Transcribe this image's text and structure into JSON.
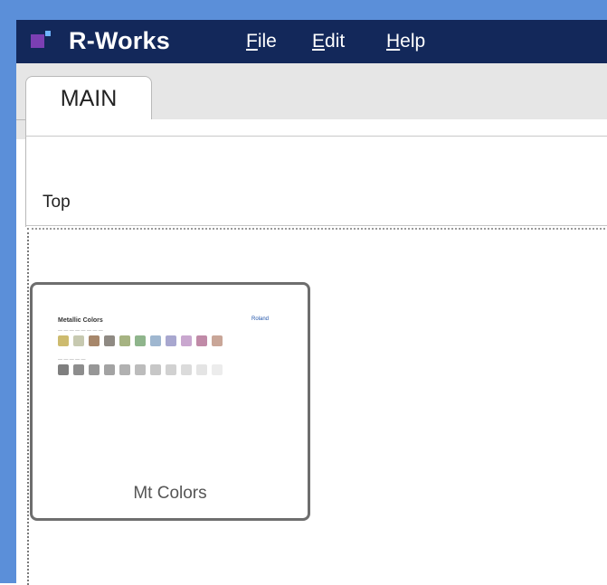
{
  "app": {
    "name": "R-Works"
  },
  "menu": {
    "items": [
      {
        "label": "File"
      },
      {
        "label": "Edit"
      },
      {
        "label": "Help"
      }
    ]
  },
  "tabs": [
    {
      "label": "MAIN",
      "active": true
    }
  ],
  "toolbar": {
    "label": "Top"
  },
  "cards": [
    {
      "label": "Mt Colors",
      "thumbnail": {
        "title": "Metallic Colors",
        "brand": "Roland",
        "swatch_rows": [
          [
            "#cdbb6f",
            "#c7c9b0",
            "#a7876b",
            "#8f8a83",
            "#a6b382",
            "#8fb58c",
            "#9fb7d0",
            "#a8a7cf",
            "#c9a7cf",
            "#c08aa7",
            "#c9a698"
          ],
          [
            "#7f7f7f",
            "#8d8d8d",
            "#979797",
            "#a3a3a3",
            "#b1b1b1",
            "#bcbcbc",
            "#c7c7c7",
            "#d1d1d1",
            "#dbdbdb",
            "#e4e4e4",
            "#ececec"
          ]
        ]
      }
    }
  ],
  "colors": {
    "title_bar": "#13285a",
    "window_frame": "#5b8fd9",
    "logo_accent": "#7b3fb3"
  }
}
